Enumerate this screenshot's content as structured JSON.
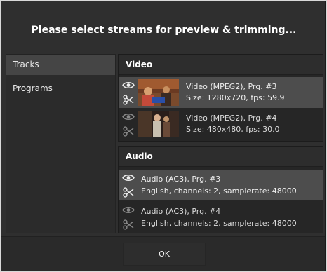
{
  "dialog": {
    "title": "Please select streams for preview & trimming...",
    "ok_label": "OK"
  },
  "sidebar": {
    "items": [
      {
        "label": "Tracks",
        "selected": true
      },
      {
        "label": "Programs",
        "selected": false
      }
    ]
  },
  "video": {
    "heading": "Video",
    "streams": [
      {
        "line1": "Video (MPEG2), Prg. #3",
        "line2": "Size: 1280x720, fps: 59.9",
        "selected": true
      },
      {
        "line1": "Video (MPEG2), Prg. #4",
        "line2": "Size: 480x480, fps: 30.0",
        "selected": false
      }
    ]
  },
  "audio": {
    "heading": "Audio",
    "streams": [
      {
        "line1": "Audio (AC3), Prg. #3",
        "line2": "English, channels: 2, samplerate: 48000",
        "selected": true
      },
      {
        "line1": "Audio (AC3), Prg. #4",
        "line2": "English, channels: 2, samplerate: 48000",
        "selected": false
      }
    ]
  },
  "icons": {
    "preview": "eye-icon",
    "trim": "scissors-icon"
  },
  "colors": {
    "dialog_bg": "#2f2f2f",
    "selected_row": "#4d4d4d",
    "text": "#eeeeee"
  }
}
